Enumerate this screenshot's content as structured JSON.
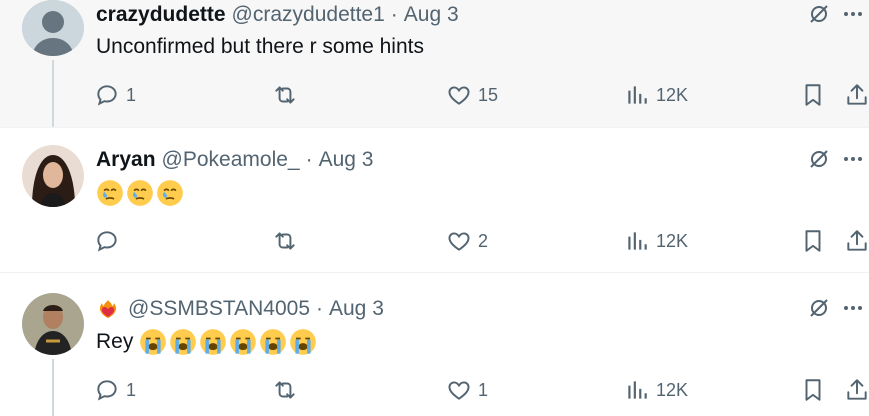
{
  "tweets": [
    {
      "name": "crazydudette",
      "handle": "@crazydudette1",
      "dot": "·",
      "date": "Aug 3",
      "text": "Unconfirmed but there r some hints",
      "avatar_icon": "default-avatar-icon",
      "replies": "1",
      "reposts": "",
      "likes": "15",
      "views": "12K"
    },
    {
      "name": "Aryan",
      "handle": "@Pokeamole_",
      "dot": "·",
      "date": "Aug 3",
      "text": "",
      "emojis": [
        "face-holding-back-tears",
        "face-holding-back-tears",
        "face-holding-back-tears"
      ],
      "avatar_icon": "user-photo-avatar",
      "replies": "",
      "reposts": "",
      "likes": "2",
      "views": "12K"
    },
    {
      "name": "",
      "name_emoji": "heart-on-fire",
      "handle": "@SSMBSTAN4005",
      "dot": "·",
      "date": "Aug 3",
      "text": "Rey",
      "emojis": [
        "loudly-crying-face",
        "loudly-crying-face",
        "loudly-crying-face",
        "loudly-crying-face",
        "loudly-crying-face",
        "loudly-crying-face"
      ],
      "avatar_icon": "user-photo-avatar",
      "replies": "1",
      "reposts": "",
      "likes": "1",
      "views": "12K"
    }
  ],
  "colors": {
    "muted": "#536471",
    "text": "#0f1419",
    "thread_line": "#cfd9de",
    "hover_bg": "#f7f7f7"
  }
}
